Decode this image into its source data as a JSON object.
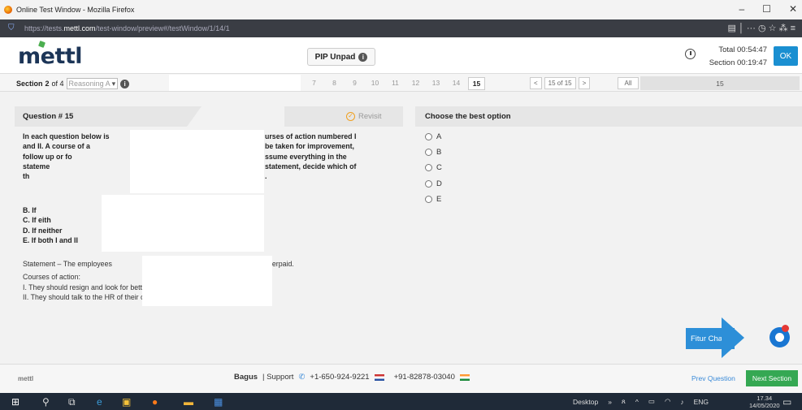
{
  "window": {
    "title": "Online Test Window - Mozilla Firefox",
    "min": "–",
    "restore": "☐",
    "close": "✕"
  },
  "browser": {
    "url_prefix": "https://tests.",
    "url_host": "mettl.com",
    "url_path": "/test-window/preview#/testWindow/1/14/1",
    "right_icons": "▤ │ ··· ◷ ☆   ⁂ ≡"
  },
  "header": {
    "logo": "mettl",
    "test_name": "PIP Unpad",
    "total_time": "Total 00:54:47",
    "section_time": "Section 00:19:47",
    "ok_label": "OK"
  },
  "section": {
    "label_prefix": "Section",
    "number": "2",
    "of_text": "of 4",
    "selected": "Reasoning A",
    "question_numbers": [
      "7",
      "8",
      "9",
      "10",
      "11",
      "12",
      "13",
      "14",
      "15"
    ],
    "current": "15",
    "pager_prev": "<",
    "pager_text": "15 of 15",
    "pager_next": ">",
    "all_label": "All",
    "count": "15"
  },
  "question": {
    "title": "Question # 15",
    "revisit_label": "Revisit",
    "text_left": [
      "In each question below is",
      "and II. A course of a",
      "follow up or fo",
      "stateme",
      "th"
    ],
    "text_right": [
      "urses of action numbered I",
      "be taken for improvement,",
      "ssume everything in the",
      "statement, decide which of",
      "."
    ],
    "options": [
      "B. If",
      "C. If eith",
      "D. If neither",
      "E. If both I and II"
    ],
    "statement_left": "Statement – The employees",
    "statement_right": "derpaid.",
    "courses_label": "Courses of action:",
    "course_1": "I. They should resign and look for bett",
    "course_2": "II. They should talk to the HR of their compa"
  },
  "answer": {
    "title": "Choose the best option",
    "options": [
      "A",
      "B",
      "C",
      "D",
      "E"
    ]
  },
  "chat": {
    "label": "Fitur Chat"
  },
  "footer": {
    "powered": "mettl",
    "support_name": "Bagus",
    "support_label": "| Support",
    "phone_us": "+1-650-924-9221",
    "phone_in": "+91-82878-03040",
    "prev_label": "Prev Question",
    "next_label": "Next Section"
  },
  "taskbar": {
    "desktop_label": "Desktop",
    "lang": "ENG",
    "time": "17.34",
    "date": "14/05/2020"
  }
}
